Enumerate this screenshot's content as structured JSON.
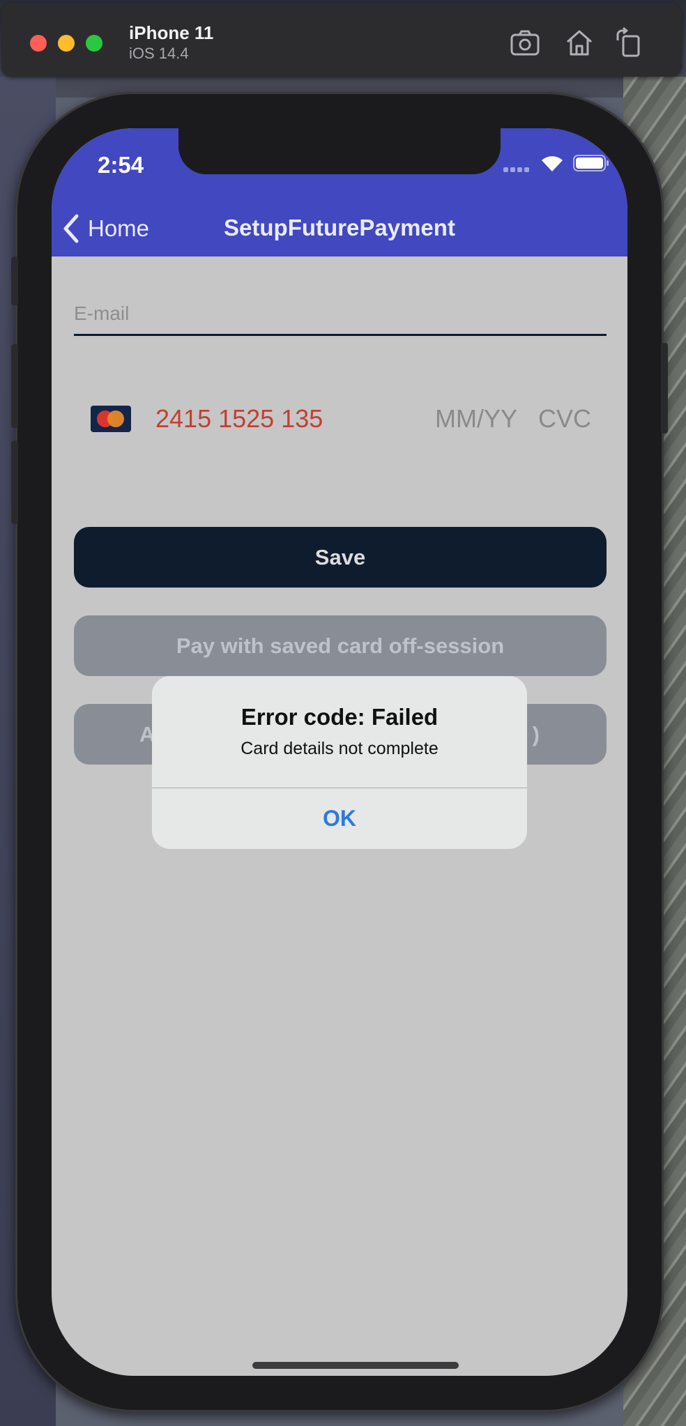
{
  "simulator": {
    "device_name": "iPhone 11",
    "os_version": "iOS 14.4",
    "toolbar_icons": [
      "screenshot-icon",
      "home-icon",
      "rotate-icon"
    ]
  },
  "status_bar": {
    "time": "2:54",
    "icons": [
      "signal-icon",
      "wifi-icon",
      "battery-icon"
    ]
  },
  "nav_bar": {
    "back_label": "Home",
    "title": "SetupFuturePayment",
    "background_color": "#4148c0"
  },
  "form": {
    "email_placeholder": "E-mail",
    "email_value": "",
    "card": {
      "brand_icon": "mastercard-icon",
      "number": "2415 1525 135",
      "expiry_placeholder": "MM/YY",
      "cvc_placeholder": "CVC",
      "number_color": "#c24031"
    },
    "buttons": {
      "save_label": "Save",
      "pay_label": "Pay with saved card off-session",
      "third_label_left": "A",
      "third_label_right": ")"
    }
  },
  "alert": {
    "title": "Error code: Failed",
    "message": "Card details not complete",
    "ok_label": "OK",
    "ok_color": "#2f79e0"
  }
}
